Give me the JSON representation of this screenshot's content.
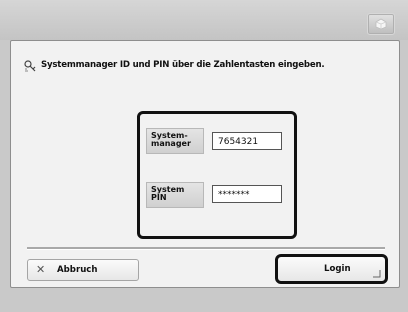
{
  "screen": {
    "message": "Systemmanager ID und PIN über die Zahlentasten eingeben."
  },
  "login_form": {
    "manager_label": "System-\nmanager",
    "manager_value": "7654321",
    "pin_label": "System\nPIN",
    "pin_value": "*******"
  },
  "footer": {
    "cancel_label": "Abbruch",
    "login_label": "Login"
  },
  "icons": {
    "top_right": "settings-icon",
    "message": "key-icon",
    "cancel": "close-icon"
  },
  "colors": {
    "accent": "#111111",
    "panel": "#f2f2f2",
    "frame": "#c9c9c9"
  }
}
